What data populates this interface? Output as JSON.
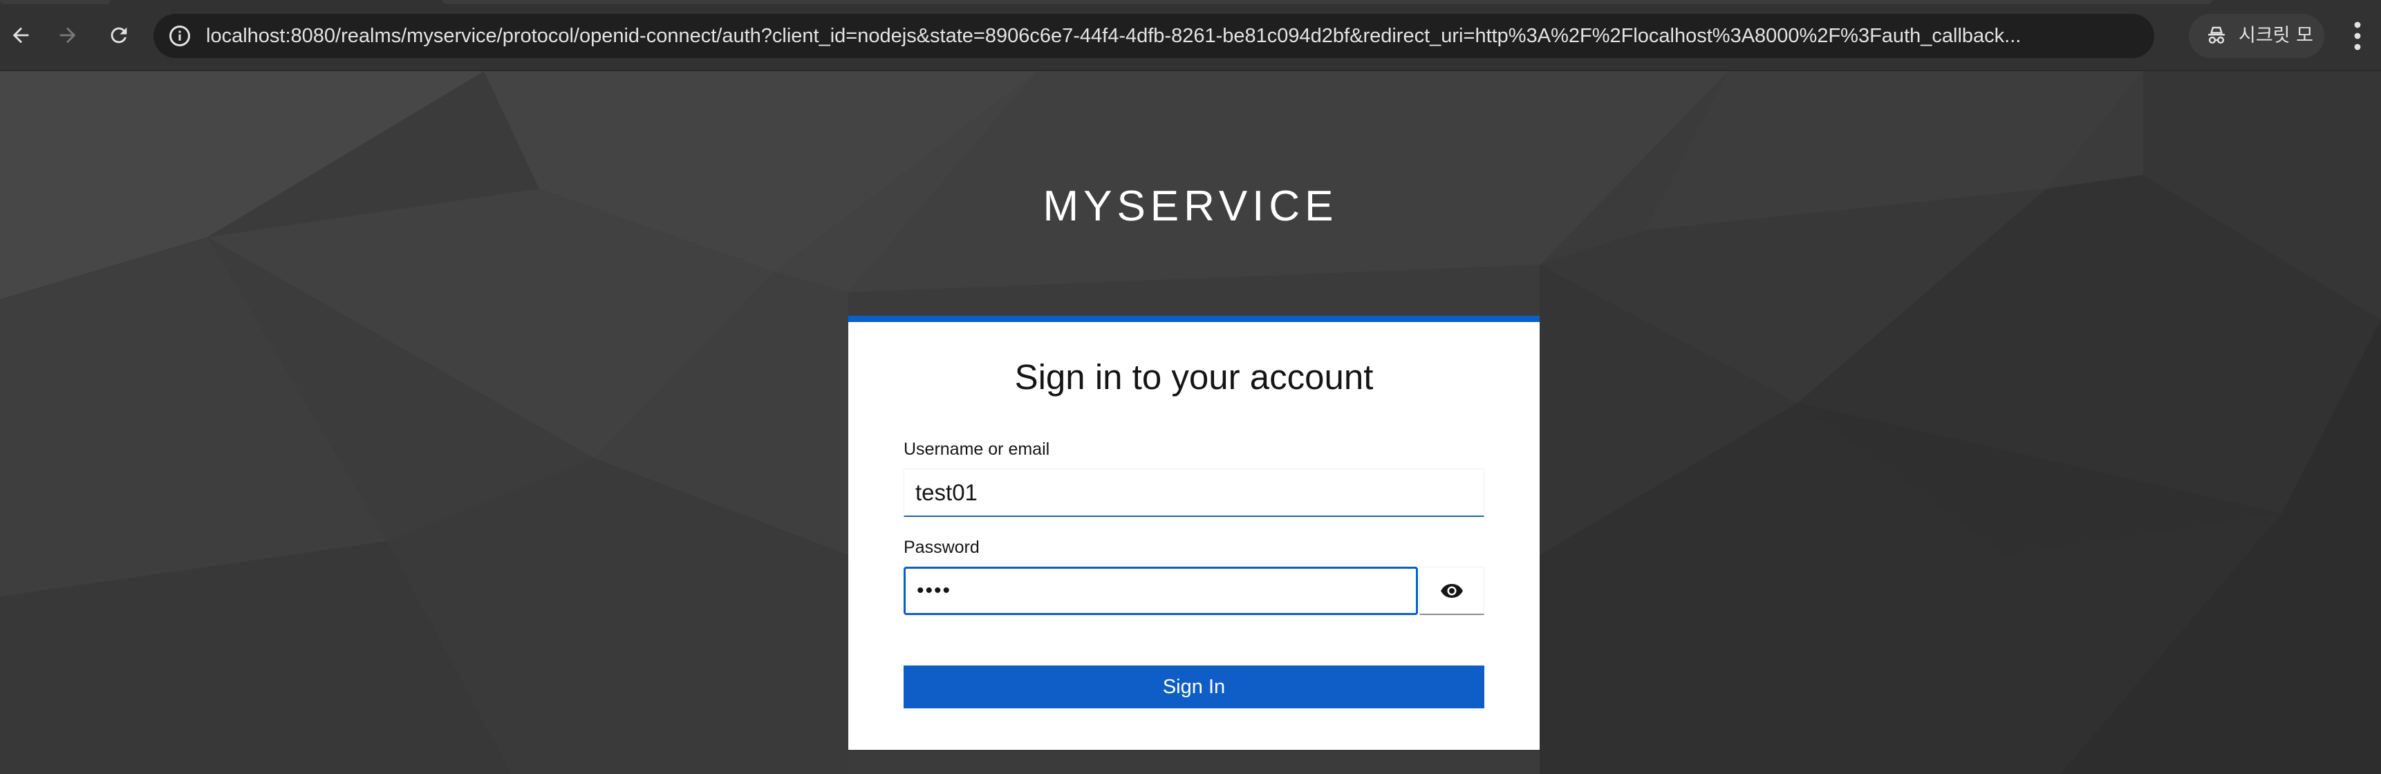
{
  "browser": {
    "url": "localhost:8080/realms/myservice/protocol/openid-connect/auth?client_id=nodejs&state=8906c6e7-44f4-4dfb-8261-be81c094d2bf&redirect_uri=http%3A%2F%2Flocalhost%3A8000%2F%3Fauth_callback...",
    "incognito_label": "시크릿 모드",
    "icons": [
      "back-arrow-icon",
      "forward-arrow-icon",
      "reload-icon",
      "site-info-icon",
      "bookmark-star-icon",
      "incognito-icon",
      "menu-dots-icon"
    ]
  },
  "page": {
    "realm_title": "MYSERVICE",
    "card": {
      "title": "Sign in to your account",
      "username_label": "Username or email",
      "username_value": "test01",
      "password_label": "Password",
      "password_value": "••••",
      "show_password_icon": "eye-icon",
      "submit_label": "Sign In"
    }
  },
  "colors": {
    "accent": "#0b5fc8",
    "chrome_bg": "#323232",
    "omnibox_bg": "#1f1f1f",
    "page_bg": "#3b3b3b"
  }
}
